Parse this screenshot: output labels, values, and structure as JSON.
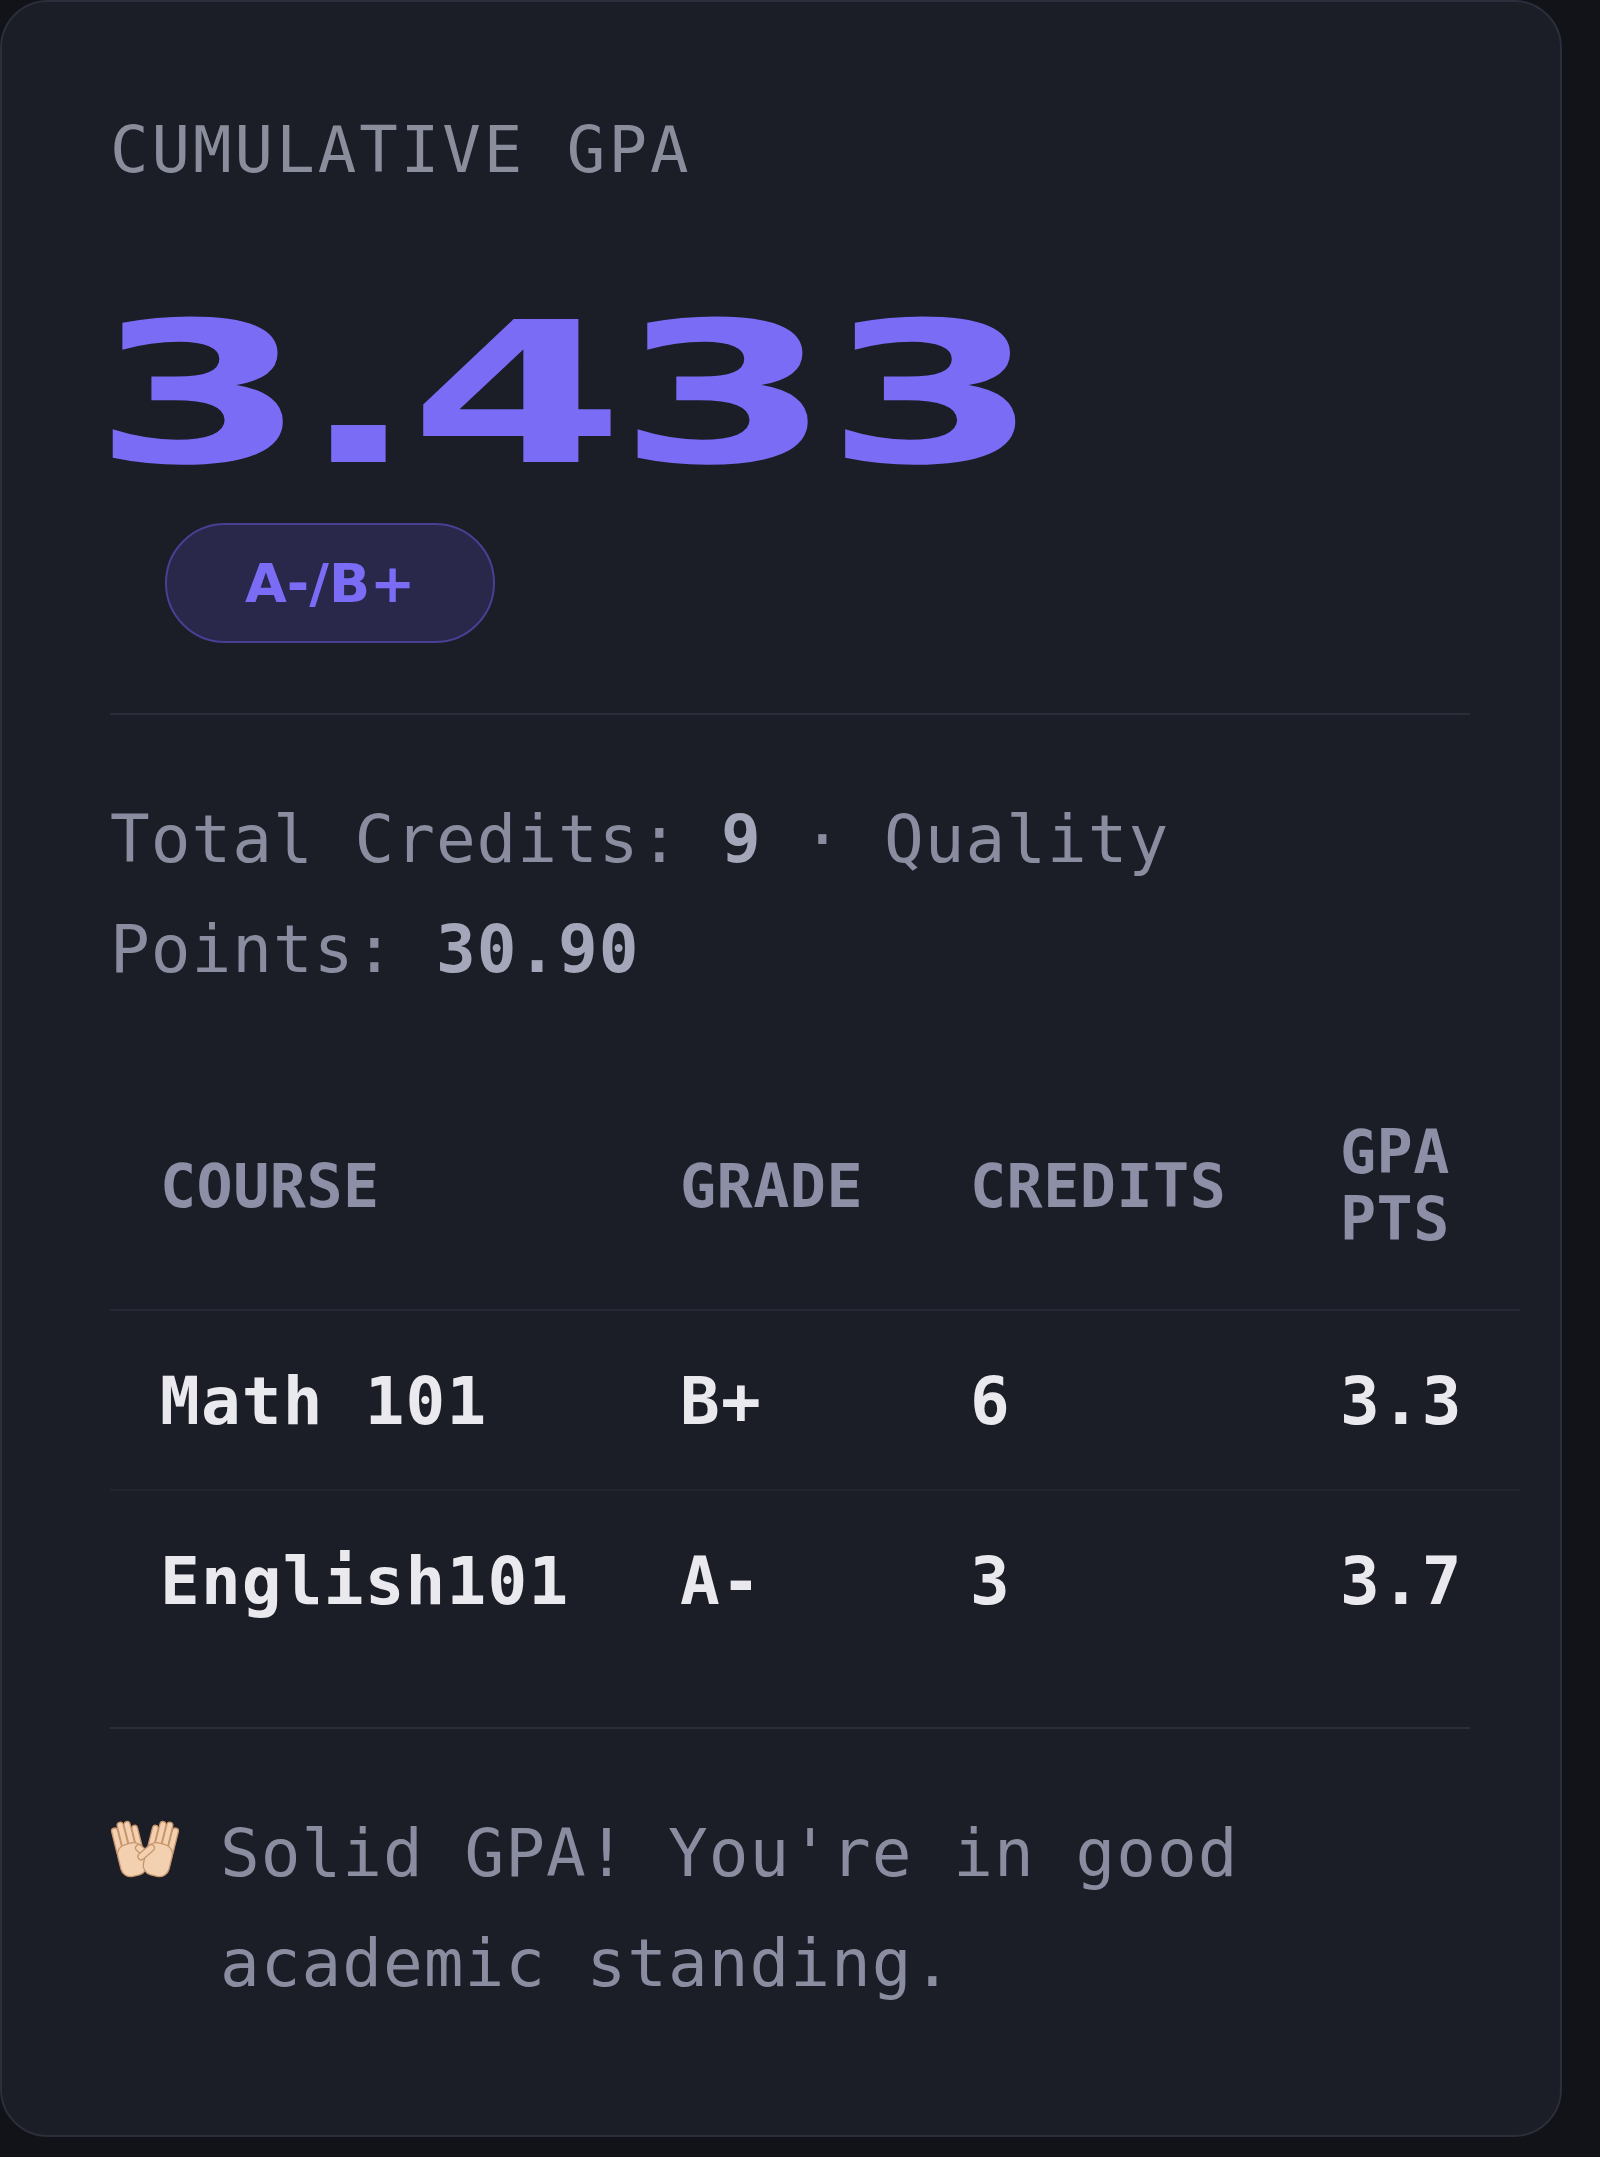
{
  "card": {
    "title": "CUMULATIVE GPA",
    "gpa": "3.433",
    "grade_badge": "A-/B+"
  },
  "summary": "Total Credits: **9** · Quality Points: **30.90**",
  "table": {
    "columns": [
      "COURSE",
      "GRADE",
      "CREDITS",
      "GPA PTS"
    ],
    "rows": [
      [
        "Math 101",
        "B+",
        "6",
        "3.3"
      ],
      [
        "English101",
        "A-",
        "3",
        "3.7"
      ]
    ]
  },
  "message": "Solid GPA! You're in good academic standing."
}
